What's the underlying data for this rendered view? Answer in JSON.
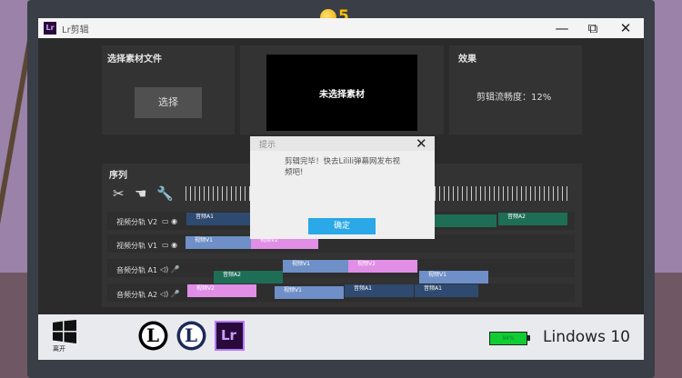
{
  "hud": {
    "coins": "5"
  },
  "window": {
    "title": "Lr剪辑",
    "logo_text": "Lr",
    "minimize": "—",
    "maximize": "⧉",
    "close": "✕"
  },
  "panels": {
    "source": {
      "title": "选择素材文件",
      "button": "选择"
    },
    "preview": {
      "text": "未选择素材"
    },
    "effect": {
      "title": "效果",
      "text": "剪辑流畅度：12%"
    }
  },
  "sequence": {
    "title": "序列",
    "tools": [
      "scissors-icon",
      "hand-icon",
      "wrench-icon"
    ],
    "tracks": [
      {
        "label": "视频分轨 V2",
        "icons": "▭ ◉"
      },
      {
        "label": "视频分轨 V1",
        "icons": "▭ ◉"
      },
      {
        "label": "音频分轨 A1",
        "icons": "◁) 🎤"
      },
      {
        "label": "音频分轨 A2",
        "icons": "◁) 🎤"
      }
    ],
    "clips": {
      "v2a": "音频A1",
      "v2b": "音频A2",
      "v1a": "视频V1",
      "v1b": "视频V2",
      "a1a": "音频A2",
      "a1b": "视频V1",
      "a1c": "视频V2",
      "a1d": "视频V1",
      "a2a": "视频V2",
      "a2b": "视频V1",
      "a2c": "音频A1",
      "a2d": "音频A1"
    }
  },
  "dialog": {
    "title": "提示",
    "message": "剪辑完毕！快去Lilili弹幕网发布视频吧!",
    "ok": "确定",
    "close": "✕"
  },
  "taskbar": {
    "start_label": "离开",
    "battery": "94%",
    "os_name": "Lindows 10",
    "apps": [
      {
        "name": "L-app-icon",
        "glyph": "L"
      },
      {
        "name": "lilili-app-icon",
        "glyph": "L"
      },
      {
        "name": "lr-app-icon",
        "glyph": "Lr"
      }
    ]
  }
}
